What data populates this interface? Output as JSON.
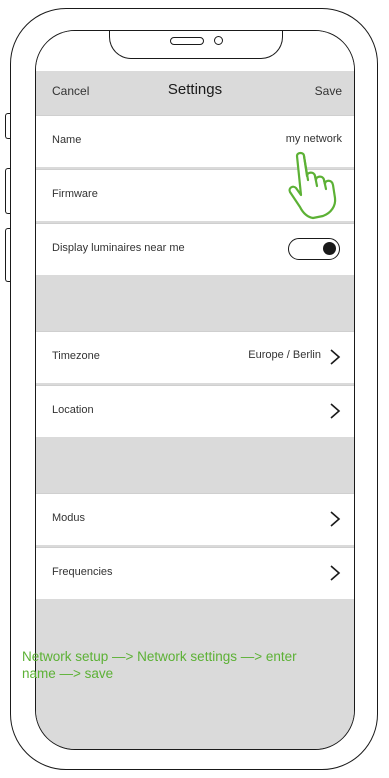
{
  "nav": {
    "cancel": "Cancel",
    "title": "Settings",
    "save": "Save"
  },
  "settings": {
    "name_label": "Name",
    "name_value": "my network",
    "firmware_label": "Firmware",
    "luminaires_label": "Display luminaires near me",
    "luminaires_enabled": true,
    "timezone_label": "Timezone",
    "timezone_value": "Europe / Berlin",
    "location_label": "Location",
    "modus_label": "Modus",
    "frequencies_label": "Frequencies"
  },
  "instruction": "Network setup —> Network settings —> enter name —> save",
  "colors": {
    "accent": "#5cb135",
    "background": "#dadada",
    "row": "#ffffff"
  },
  "icons": {
    "chevron": "chevron-right-icon",
    "hand": "pointing-hand-icon"
  }
}
